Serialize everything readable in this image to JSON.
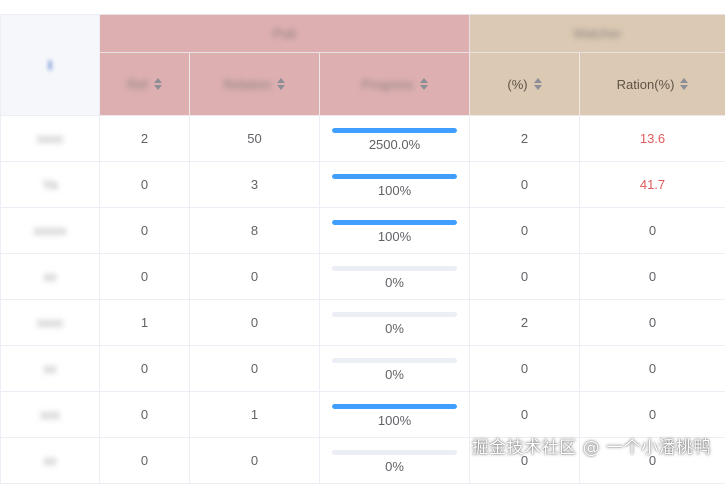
{
  "header": {
    "corner": "l",
    "group_pub": "Pub",
    "group_watcher": "Watcher",
    "columns": [
      "Ref",
      "Relation",
      "Progress",
      "(%)",
      "Ration(%)"
    ]
  },
  "rows": [
    {
      "label": "xxxx",
      "c1": "2",
      "c2": "50",
      "pct": "2500.0%",
      "fill": 1.0,
      "c4": "2",
      "c5": "13.6",
      "c5_red": true
    },
    {
      "label": "Ya",
      "c1": "0",
      "c2": "3",
      "pct": "100%",
      "fill": 1.0,
      "c4": "0",
      "c5": "41.7",
      "c5_red": true
    },
    {
      "label": "xxxxx",
      "c1": "0",
      "c2": "8",
      "pct": "100%",
      "fill": 1.0,
      "c4": "0",
      "c5": "0",
      "c5_red": false
    },
    {
      "label": "xx",
      "c1": "0",
      "c2": "0",
      "pct": "0%",
      "fill": 0.0,
      "c4": "0",
      "c5": "0",
      "c5_red": false
    },
    {
      "label": "xxxx",
      "c1": "1",
      "c2": "0",
      "pct": "0%",
      "fill": 0.0,
      "c4": "2",
      "c5": "0",
      "c5_red": false
    },
    {
      "label": "xx",
      "c1": "0",
      "c2": "0",
      "pct": "0%",
      "fill": 0.0,
      "c4": "0",
      "c5": "0",
      "c5_red": false
    },
    {
      "label": "xxx",
      "c1": "0",
      "c2": "1",
      "pct": "100%",
      "fill": 1.0,
      "c4": "0",
      "c5": "0",
      "c5_red": false
    },
    {
      "label": "xx",
      "c1": "0",
      "c2": "0",
      "pct": "0%",
      "fill": 0.0,
      "c4": "0",
      "c5": "0",
      "c5_red": false
    }
  ],
  "colors": {
    "pub_header": "#ddafb1",
    "watcher_header": "#dbc9b3",
    "progress_fill": "#409eff",
    "progress_track": "#ebeef5",
    "alert_text": "#e15b5b"
  },
  "watermark": "掘金技术社区 @ 一个小潘桃鸭"
}
